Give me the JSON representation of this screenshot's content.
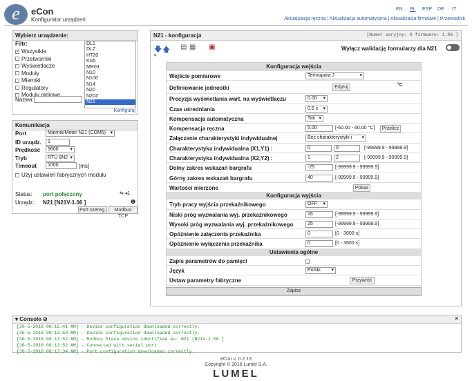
{
  "app": {
    "logo": "e",
    "logo_sub": "CON",
    "name": "eCon",
    "subtitle": "Konfigurator urządzeń"
  },
  "languages": [
    "EN",
    "PL",
    "ESP",
    "DE",
    "IT"
  ],
  "top_links": "Aktualizacja ręczna | Aktualizacja automatyczna | Aktualizacja firmware | Przewodnik",
  "device_select": {
    "title": "Wybierz urządzenie:",
    "filter_label": "Filtr:",
    "filters": [
      {
        "label": "Wszystkie",
        "checked": true
      },
      {
        "label": "Przetworniki",
        "checked": false
      },
      {
        "label": "Wyświetlacze",
        "checked": false
      },
      {
        "label": "Moduły",
        "checked": false
      },
      {
        "label": "Mierniki",
        "checked": false
      },
      {
        "label": "Regulatory",
        "checked": false
      },
      {
        "label": "Moduły radiowe",
        "checked": false
      }
    ],
    "name_label": "Nazwa:",
    "devices": [
      "DL1",
      "DLZ",
      "HT20",
      "KS5",
      "MR03",
      "N10",
      "N100",
      "N14",
      "N20",
      "N20Z",
      "N21"
    ],
    "selected": "N21",
    "link": "Konfiguruj"
  },
  "comm": {
    "title": "Komunikacja",
    "port_label": "Port",
    "port_value": "Miernik/Meter N21 (COM5)",
    "id_label": "ID urządz.",
    "id_value": "1",
    "speed_label": "Prędkość",
    "speed_value": "9600",
    "mode_label": "Tryb",
    "mode_value": "RTU 8N2",
    "timeout_label": "Timeout",
    "timeout_value": "1000",
    "timeout_unit": "[ms]",
    "factory_label": "Użyj ustawień fabrycznych modułu",
    "status_label": "Status:",
    "status_value": "port połączony",
    "device_label": "Urządz.:",
    "device_value": "N21 [N21V-1.06 ]",
    "btn_serial": "Port szereg.",
    "btn_tcp": "Modbus TCP"
  },
  "main": {
    "title": "N21 - konfiguracja",
    "serial": "[Numer seryjny: 0 firmware: 1.06 ]",
    "validation_label": "Wyłącz walidację formularzy dla N21"
  },
  "input_section": {
    "title": "Konfiguracja wejścia",
    "rows": {
      "r1": {
        "label": "Wejście pomiarowe",
        "value": "Termopara J"
      },
      "r2": {
        "label": "Definiowanie jednostki",
        "button": "Edytuj",
        "unit": "°C"
      },
      "r3": {
        "label": "Precyzja wyświetlania wart. na wyświetlaczu",
        "value": "0.00"
      },
      "r4": {
        "label": "Czas uśredniania",
        "value": "0.5 s"
      },
      "r5": {
        "label": "Kompensacja automatyczna",
        "value": "Tak"
      },
      "r6": {
        "label": "Kompensacja ręczna",
        "value": "5.00",
        "range": "[-60.00 - 60.00 °C]",
        "button": "Przelicz"
      },
      "r7": {
        "label": "Załączenie charakterystyki indywidualnej",
        "value": "Bez charakterystyki i"
      },
      "r8": {
        "label": "Charakterystyka indywidualna (X1,Y1) :",
        "v1": "0",
        "v2": "0",
        "range": "[-99999.9 - 99999.9]"
      },
      "r9": {
        "label": "Charakterystyka indywidualna (X2,Y2) :",
        "v1": "1",
        "v2": "2",
        "range": "[-99999.9 - 99999.9]"
      },
      "r10": {
        "label": "Dolny zakres wskazań bargrafu",
        "value": "-25",
        "range": "[-99999.9 - 99999.9]"
      },
      "r11": {
        "label": "Górny zakres wskazań bargrafu",
        "value": "40",
        "range": "[-99999.9 - 99999.9]"
      },
      "r12": {
        "label": "Wartości mierzone",
        "button": "Pokaz"
      }
    }
  },
  "output_section": {
    "title": "Konfiguracja wyjścia",
    "rows": {
      "r1": {
        "label": "Tryb pracy wyjścia przekaźnikowego",
        "value": "OFF"
      },
      "r2": {
        "label": "Niski próg wyzwalania wyj. przekaźnikowego",
        "value": "16",
        "range": "[-99999.9 - 99999.9]"
      },
      "r3": {
        "label": "Wysoki próg wyzwalania wyj. przekaźnikowego",
        "value": "25",
        "range": "[-99999.9 - 99999.9]"
      },
      "r4": {
        "label": "Opóźnienie załączenia przekaźnika",
        "value": "0",
        "range": "[0 - 3600 s]"
      },
      "r5": {
        "label": "Opóźnienie wyłączenia przekaźnika",
        "value": "0",
        "range": "[0 - 3600 s]"
      }
    }
  },
  "general_section": {
    "title": "Ustawienia ogólne",
    "rows": {
      "r1": {
        "label": "Zapis parametrów do pamięci"
      },
      "r2": {
        "label": "Język",
        "value": "Polski"
      },
      "r3": {
        "label": "Ustaw parametry fabryczne",
        "button": "Przywróć"
      }
    }
  },
  "save_button": "Zapisz",
  "console": {
    "title": "Console",
    "lines": [
      "[30-5-2018 08:15:41 AM] - Device configuration downloaded correctly.",
      "[30-5-2018 08:13:53 AM] - Device configuration downloaded correctly.",
      "[30-5-2018 08:13:52 AM] - Modbus Slave device identified as: N21 [N21V-1.06 ]",
      "[30-5-2018 08:13:52 AM] - Connected with serial port.",
      "[30-5-2018 08:13:34 AM] - Port configuration downloaded correctly."
    ]
  },
  "footer": {
    "version": "eCon v. 0.2.13",
    "copyright": "Copyright © 2016 Lumel S.A.",
    "brand": "LUMEL"
  },
  "colors": {
    "link": "#2a5fa0",
    "status_ok": "#2b8a2b",
    "selection": "#3369c9",
    "log": "#2b8a2b"
  }
}
